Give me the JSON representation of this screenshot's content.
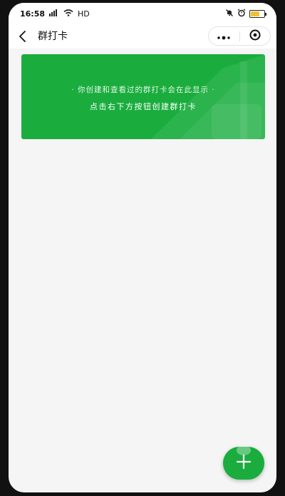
{
  "status_bar": {
    "time": "16:58",
    "network": "HD"
  },
  "nav": {
    "title": "群打卡"
  },
  "banner": {
    "line1": "· 你创建和查看过的群打卡会在此显示 ·",
    "line2": "点击右下方按钮创建群打卡"
  },
  "colors": {
    "brand_green": "#1aad3e",
    "background": "#f5f5f5",
    "battery": "#f1c232"
  },
  "icons": {
    "back": "chevron-left-icon",
    "more": "more-dots-icon",
    "close": "target-circle-icon",
    "add": "plus-icon",
    "signal": "signal-icon",
    "wifi": "wifi-icon",
    "mute": "mute-bell-icon",
    "alarm": "alarm-icon",
    "battery": "battery-icon"
  }
}
